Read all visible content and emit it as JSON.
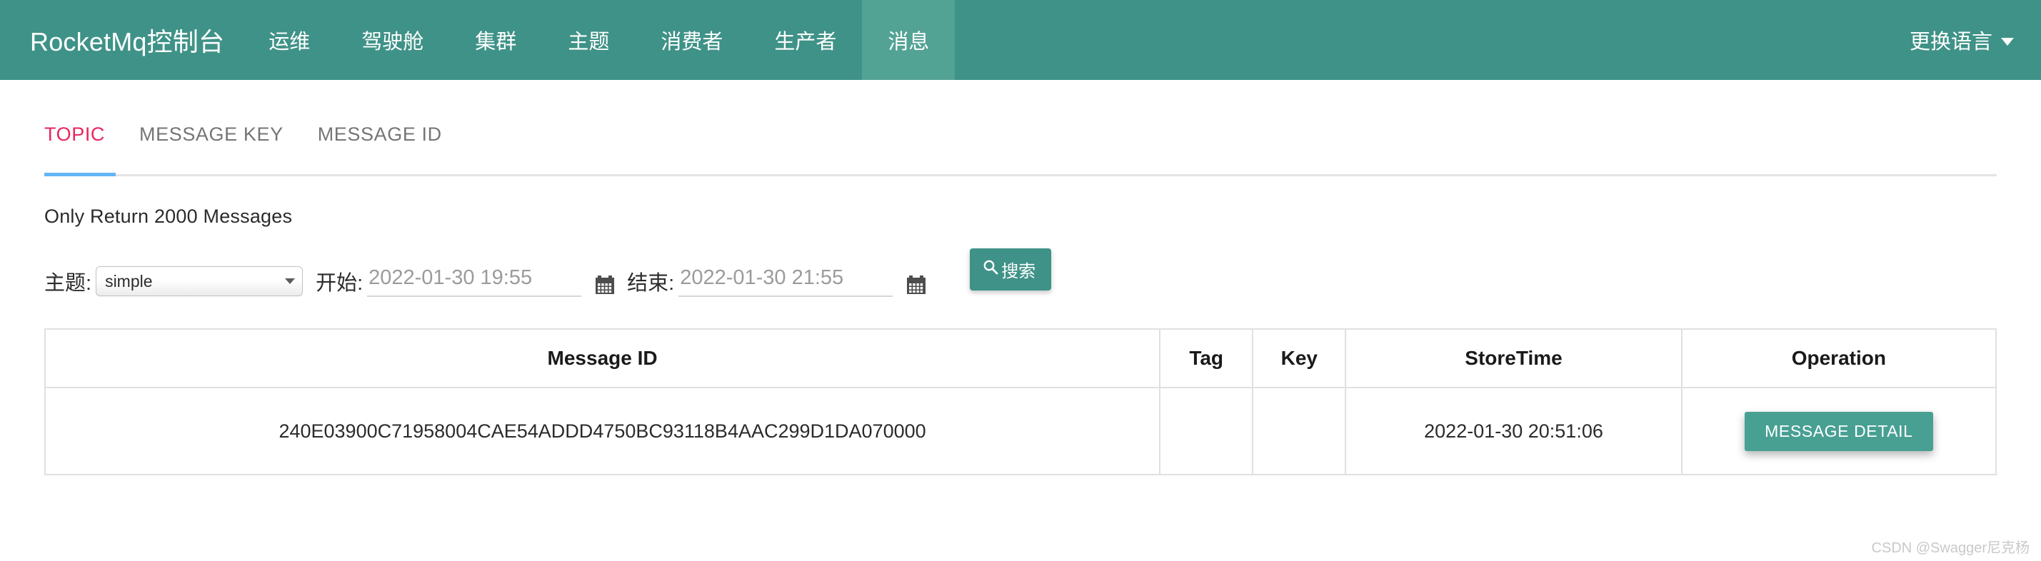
{
  "header": {
    "brand": "RocketMq控制台",
    "nav_items": [
      {
        "label": "运维",
        "active": false
      },
      {
        "label": "驾驶舱",
        "active": false
      },
      {
        "label": "集群",
        "active": false
      },
      {
        "label": "主题",
        "active": false
      },
      {
        "label": "消费者",
        "active": false
      },
      {
        "label": "生产者",
        "active": false
      },
      {
        "label": "消息",
        "active": true
      }
    ],
    "language_label": "更换语言",
    "bg_color": "#3f9287",
    "active_bg_color": "#53a395"
  },
  "tabs": {
    "items": [
      {
        "label": "TOPIC",
        "active": true
      },
      {
        "label": "MESSAGE KEY",
        "active": false
      },
      {
        "label": "MESSAGE ID",
        "active": false
      }
    ],
    "active_color": "#e8255e",
    "underline_color": "#64b5f6"
  },
  "notice": "Only Return 2000 Messages",
  "filters": {
    "topic_label": "主题:",
    "topic_value": "simple",
    "begin_label": "开始:",
    "begin_placeholder": "2022-01-30 19:55",
    "begin_value": "",
    "end_label": "结束:",
    "end_placeholder": "2022-01-30 21:55",
    "end_value": "",
    "search_label": "搜索",
    "search_icon": "search-icon",
    "calendar_icon": "calendar-icon"
  },
  "table": {
    "columns": [
      "Message ID",
      "Tag",
      "Key",
      "StoreTime",
      "Operation"
    ],
    "rows": [
      {
        "message_id": "240E03900C71958004CAE54ADDD4750BC93118B4AAC299D1DA070000",
        "tag": "",
        "key": "",
        "store_time": "2022-01-30 20:51:06",
        "operation_label": "MESSAGE DETAIL"
      }
    ],
    "detail_button_color": "#48a093"
  },
  "watermark": "CSDN @Swagger尼克杨"
}
